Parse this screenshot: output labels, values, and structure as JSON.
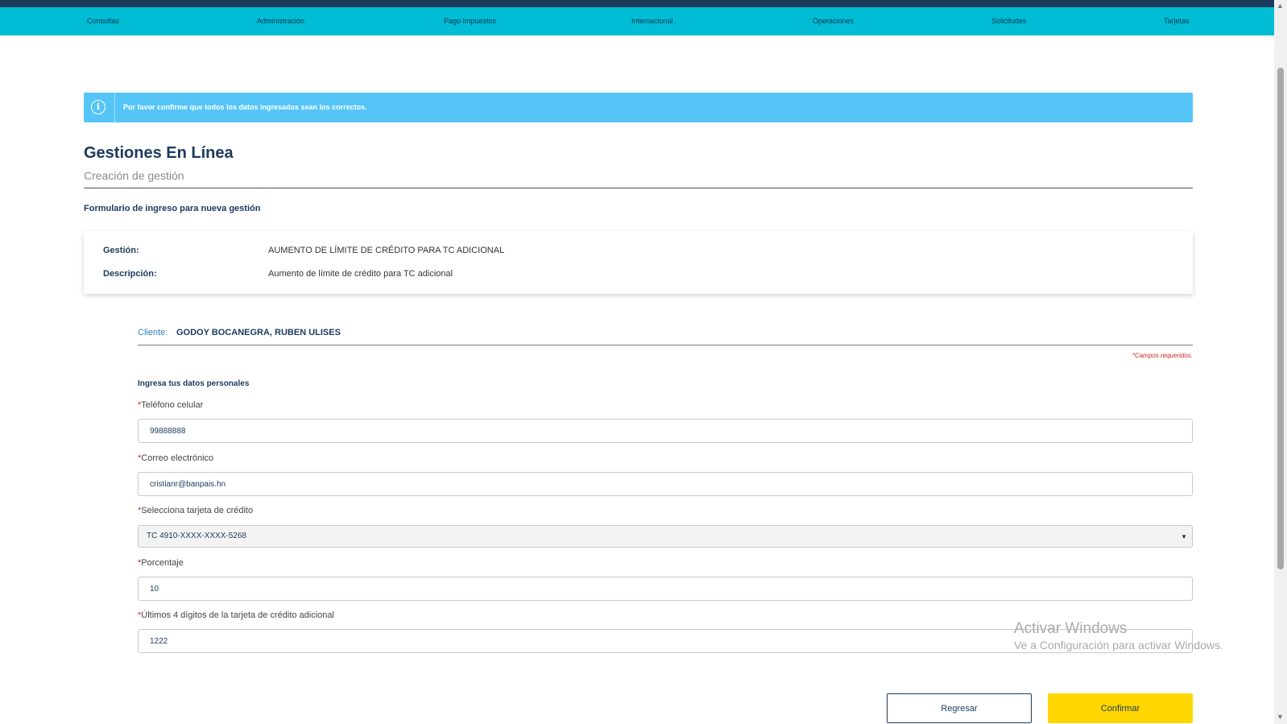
{
  "nav": {
    "items": [
      {
        "label": "Consultas"
      },
      {
        "label": "Administración"
      },
      {
        "label": "Pago Impuestos"
      },
      {
        "label": "Internacional"
      },
      {
        "label": "Operaciones"
      },
      {
        "label": "Solicitudes"
      },
      {
        "label": "Tarjetas"
      }
    ]
  },
  "alert": {
    "icon": "info-icon",
    "text": "Por favor confirme que todos los datos ingresados sean los correctos.",
    "color": "#55c5f7"
  },
  "page": {
    "title": "Gestiones En Línea",
    "subtitle": "Creación de gestión",
    "form_heading": "Formulario de ingreso para nueva gestión"
  },
  "info_card": {
    "gestion_label": "Gestión:",
    "gestion_value": "AUMENTO DE LÍMITE DE CRÉDITO PARA TC ADICIONAL",
    "descripcion_label": "Descripción:",
    "descripcion_value": "Aumento de límite de crédito para TC adicional"
  },
  "client": {
    "label": "Cliente:",
    "name": "GODOY BOCANEGRA, RUBEN ULISES"
  },
  "required_note": "*Campos requeridos.",
  "section_label": "Ingresa tus datos personales",
  "fields": {
    "phone": {
      "label": "Teléfono celular",
      "value": "99888888"
    },
    "email": {
      "label": "Correo electrónico",
      "value": "cristianr@banpais.hn"
    },
    "card": {
      "label": "Selecciona tarjeta de crédito",
      "value": "TC 4910-XXXX-XXXX-5268"
    },
    "percentage": {
      "label": "Porcentaje",
      "value": "10"
    },
    "last_digits": {
      "label": "Últimos 4 dígitos de la tarjeta de crédito adicional",
      "value": "1222"
    }
  },
  "required_marker": "*",
  "buttons": {
    "back": "Regresar",
    "confirm": "Confirmar"
  },
  "watermark": {
    "title": "Activar Windows",
    "subtitle": "Ve a Configuración para activar Windows."
  },
  "colors": {
    "nav_bg": "#00bcd4",
    "top_strip": "#1b3a5c",
    "primary_text": "#1b3a5c",
    "confirm_button": "#ffd600",
    "required": "#c62828"
  }
}
